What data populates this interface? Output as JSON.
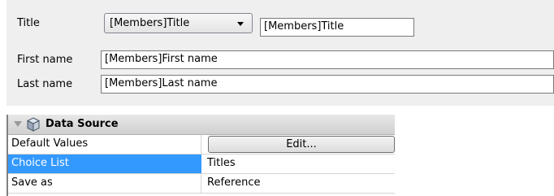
{
  "form": {
    "title_label": "Title",
    "title_combo_value": "[Members]Title",
    "title_field_value": "[Members]Title",
    "first_name_label": "First name",
    "first_name_value": "[Members]First name",
    "last_name_label": "Last name",
    "last_name_value": "[Members]Last name"
  },
  "property_list": {
    "section_title": "Data Source",
    "section_icon": "database-cube-icon",
    "rows": [
      {
        "label": "Default Values",
        "button_label": "Edit..."
      },
      {
        "label": "Choice List",
        "value": "Titles",
        "selected": true
      },
      {
        "label": "Save as",
        "value": "Reference"
      }
    ]
  },
  "colors": {
    "panel_background": "#efefef",
    "selection_blue": "#3399ff"
  }
}
